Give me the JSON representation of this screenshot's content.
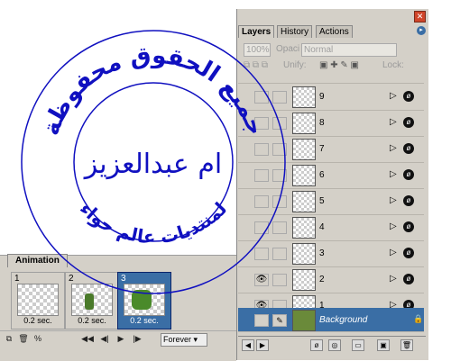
{
  "animation": {
    "tab_label": "Animation",
    "frames": [
      {
        "number": "1",
        "delay": "0.2 sec."
      },
      {
        "number": "2",
        "delay": "0.2 sec."
      },
      {
        "number": "3",
        "delay": "0.2 sec."
      }
    ],
    "selected_frame": "3",
    "loop_option": "Forever"
  },
  "layers_panel": {
    "tabs": [
      "Layers",
      "History",
      "Actions"
    ],
    "opacity_value": "100%",
    "opacity_label": "Opaci",
    "blend_mode": "Normal",
    "unify_label": "Unify:",
    "lock_label": "Lock:",
    "layers": [
      {
        "name": "9",
        "visible": false
      },
      {
        "name": "8",
        "visible": false
      },
      {
        "name": "7",
        "visible": false
      },
      {
        "name": "6",
        "visible": false
      },
      {
        "name": "5",
        "visible": false
      },
      {
        "name": "4",
        "visible": false
      },
      {
        "name": "3",
        "visible": false
      },
      {
        "name": "2",
        "visible": true
      },
      {
        "name": "1",
        "visible": true
      },
      {
        "name": "Background",
        "visible": false,
        "selected": true
      }
    ]
  },
  "watermark": {
    "outer_text": "جميع الحقوق محفوظة",
    "center_text": "ام عبدالعزيز",
    "bottom_text": "لمنتديات عالم حواء"
  },
  "colors": {
    "panel_bg": "#d4d0c8",
    "selection": "#3a6ea5",
    "stamp": "#1010c0"
  }
}
